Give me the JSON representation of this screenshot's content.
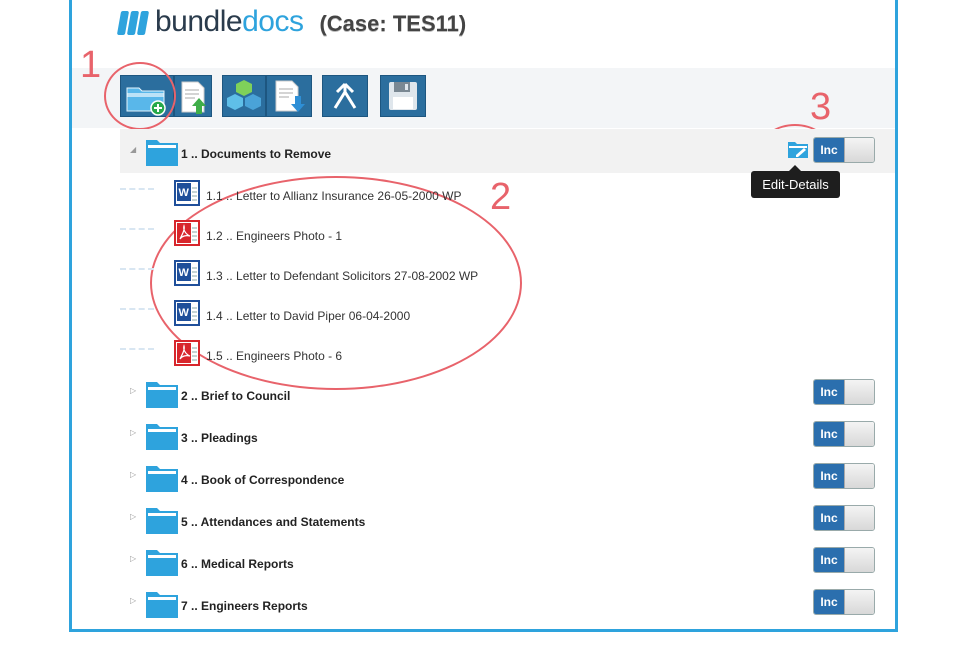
{
  "header": {
    "logo_part1": "bundle",
    "logo_part2": "docs",
    "case_label": "(Case: TES11)"
  },
  "toolbar": {
    "buttons": [
      {
        "name": "add-folder",
        "icon": "folder-plus-icon"
      },
      {
        "name": "upload-document",
        "icon": "document-upload-icon"
      },
      {
        "name": "bundle-blocks",
        "icon": "cubes-icon"
      },
      {
        "name": "download-document",
        "icon": "document-download-icon"
      },
      {
        "name": "merge",
        "icon": "merge-arrow-icon"
      },
      {
        "name": "save",
        "icon": "floppy-disk-icon"
      }
    ]
  },
  "annotations": {
    "one": "1",
    "two": "2",
    "three": "3"
  },
  "tooltip": {
    "text": "Edit-Details"
  },
  "tree": {
    "toggle_label": "Inc",
    "sections": [
      {
        "label": "1 .. Documents to Remove",
        "expanded": true
      },
      {
        "label": "2 .. Brief to Council"
      },
      {
        "label": "3 .. Pleadings"
      },
      {
        "label": "4 .. Book of Correspondence"
      },
      {
        "label": "5 .. Attendances and Statements"
      },
      {
        "label": "6 .. Medical Reports"
      },
      {
        "label": "7 .. Engineers Reports"
      }
    ],
    "documents": [
      {
        "label": "1.1 .. Letter to Allianz Insurance 26-05-2000 WP",
        "type": "word"
      },
      {
        "label": "1.2 .. Engineers Photo - 1",
        "type": "pdf"
      },
      {
        "label": "1.3 .. Letter to Defendant Solicitors 27-08-2002 WP",
        "type": "word"
      },
      {
        "label": "1.4 .. Letter to David Piper 06-04-2000",
        "type": "word"
      },
      {
        "label": "1.5 .. Engineers Photo - 6",
        "type": "pdf"
      }
    ]
  },
  "colors": {
    "accent": "#2ea3dd",
    "annotation": "#e8636b",
    "toolbar_button": "#2b6e9e"
  }
}
